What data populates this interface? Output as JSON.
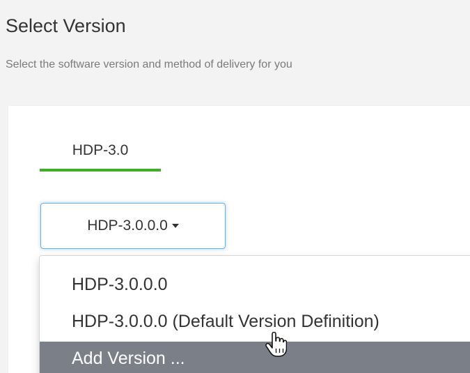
{
  "header": {
    "title": "Select Version",
    "subtitle": "Select the software version and method of delivery for you"
  },
  "tabs": [
    {
      "label": "HDP-3.0",
      "active": true
    }
  ],
  "version_select": {
    "selected": "HDP-3.0.0.0"
  },
  "dropdown": {
    "items": [
      {
        "label": "HDP-3.0.0.0"
      },
      {
        "label": "HDP-3.0.0.0 (Default Version Definition)"
      },
      {
        "label": "Add Version ...",
        "highlighted": true
      }
    ]
  },
  "cursor": {
    "icon": "hand-pointer-icon"
  },
  "colors": {
    "active_tab_underline": "#3fae2a",
    "select_focus_border": "#66afe9",
    "highlighted_item_bg": "#7b7f88",
    "page_background": "#f3f3f3"
  }
}
